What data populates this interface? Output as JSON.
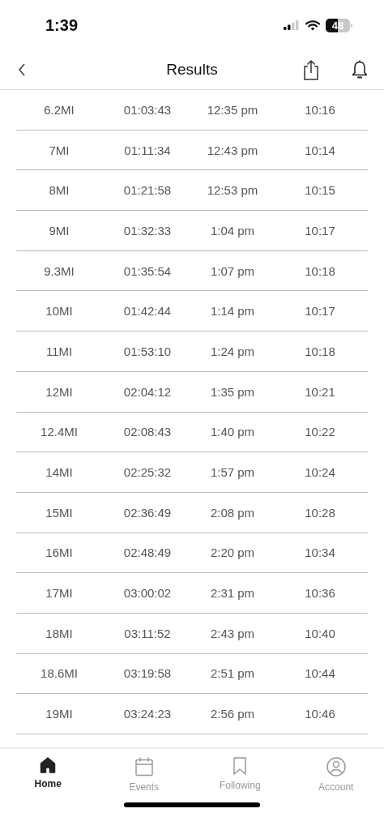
{
  "status_bar": {
    "time": "1:39",
    "battery": "48"
  },
  "nav": {
    "title": "Results"
  },
  "table": {
    "rows": [
      [
        "6.2MI",
        "01:03:43",
        "12:35 pm",
        "10:16"
      ],
      [
        "7MI",
        "01:11:34",
        "12:43 pm",
        "10:14"
      ],
      [
        "8MI",
        "01:21:58",
        "12:53 pm",
        "10:15"
      ],
      [
        "9MI",
        "01:32:33",
        "1:04 pm",
        "10:17"
      ],
      [
        "9.3MI",
        "01:35:54",
        "1:07 pm",
        "10:18"
      ],
      [
        "10MI",
        "01:42:44",
        "1:14 pm",
        "10:17"
      ],
      [
        "11MI",
        "01:53:10",
        "1:24 pm",
        "10:18"
      ],
      [
        "12MI",
        "02:04:12",
        "1:35 pm",
        "10:21"
      ],
      [
        "12.4MI",
        "02:08:43",
        "1:40 pm",
        "10:22"
      ],
      [
        "14MI",
        "02:25:32",
        "1:57 pm",
        "10:24"
      ],
      [
        "15MI",
        "02:36:49",
        "2:08 pm",
        "10:28"
      ],
      [
        "16MI",
        "02:48:49",
        "2:20 pm",
        "10:34"
      ],
      [
        "17MI",
        "03:00:02",
        "2:31 pm",
        "10:36"
      ],
      [
        "18MI",
        "03:11:52",
        "2:43 pm",
        "10:40"
      ],
      [
        "18.6MI",
        "03:19:58",
        "2:51 pm",
        "10:44"
      ],
      [
        "19MI",
        "03:24:23",
        "2:56 pm",
        "10:46"
      ]
    ]
  },
  "tabs": [
    {
      "kind": "home",
      "label": "Home",
      "selected": true
    },
    {
      "kind": "events",
      "label": "Events",
      "selected": false
    },
    {
      "kind": "following",
      "label": "Following",
      "selected": false
    },
    {
      "kind": "account",
      "label": "Account",
      "selected": false
    }
  ]
}
